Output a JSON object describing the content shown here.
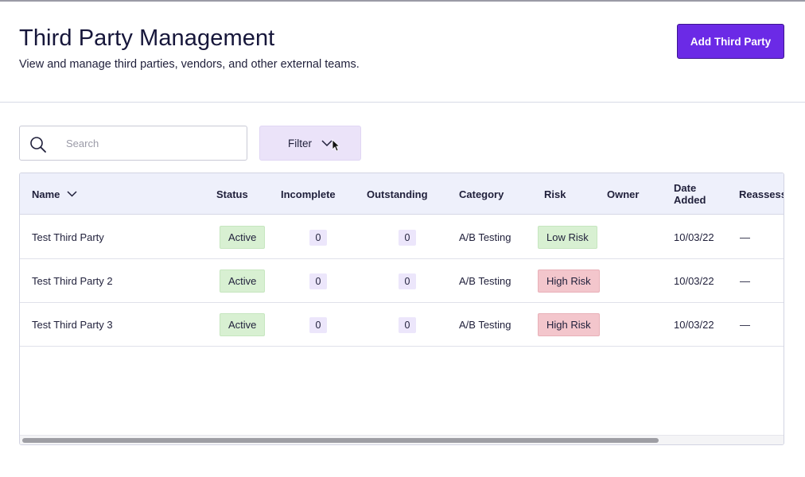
{
  "header": {
    "title": "Third Party Management",
    "subtitle": "View and manage third parties, vendors, and other external teams.",
    "add_button": "Add Third Party"
  },
  "search": {
    "placeholder": "Search",
    "value": ""
  },
  "filter": {
    "label": "Filter"
  },
  "table": {
    "columns": {
      "name": "Name",
      "status": "Status",
      "incomplete": "Incomplete",
      "outstanding": "Outstanding",
      "category": "Category",
      "risk": "Risk",
      "owner": "Owner",
      "date_added": "Date Added",
      "reassessment": "Reassessm"
    },
    "rows": [
      {
        "name": "Test Third Party",
        "status": "Active",
        "incomplete": "0",
        "outstanding": "0",
        "category": "A/B Testing",
        "risk": "Low Risk",
        "owner": "",
        "date_added": "10/03/22",
        "reassessment": "—"
      },
      {
        "name": "Test Third Party 2",
        "status": "Active",
        "incomplete": "0",
        "outstanding": "0",
        "category": "A/B Testing",
        "risk": "High Risk",
        "owner": "",
        "date_added": "10/03/22",
        "reassessment": "—"
      },
      {
        "name": "Test Third Party 3",
        "status": "Active",
        "incomplete": "0",
        "outstanding": "0",
        "category": "A/B Testing",
        "risk": "High Risk",
        "owner": "",
        "date_added": "10/03/22",
        "reassessment": "—"
      }
    ]
  },
  "icons": {
    "search": "search-icon",
    "filter_chevron": "chevron-down-icon",
    "sort": "chevron-down-icon",
    "cursor": "mouse-cursor-icon"
  },
  "colors": {
    "accent": "#6b2ae6",
    "status_active": "#d8f0d2",
    "risk_low": "#d8f0d2",
    "risk_high": "#f3c6cc",
    "count_badge": "#ece6fb",
    "header_bg": "#eef0fb"
  }
}
